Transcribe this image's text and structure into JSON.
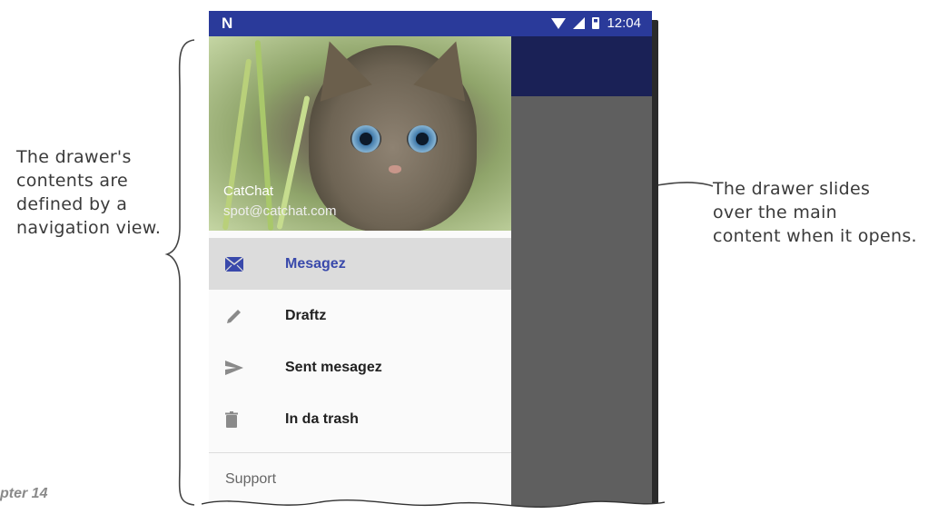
{
  "annotations": {
    "left": "The drawer's\ncontents are\ndefined by a\nnavigation view.",
    "right": "The drawer slides\nover the main\ncontent when it opens.",
    "chapter": "pter 14"
  },
  "status_bar": {
    "carrier": "N",
    "time": "12:04"
  },
  "drawer": {
    "header": {
      "name": "CatChat",
      "email": "spot@catchat.com"
    },
    "items": [
      {
        "label": "Mesagez",
        "icon": "email-icon",
        "selected": true
      },
      {
        "label": "Draftz",
        "icon": "pencil-icon",
        "selected": false
      },
      {
        "label": "Sent mesagez",
        "icon": "send-icon",
        "selected": false
      },
      {
        "label": "In da trash",
        "icon": "trash-icon",
        "selected": false
      }
    ],
    "section": "Support"
  },
  "colors": {
    "status_bar": "#2a3a9a",
    "app_bar": "#1a2156",
    "accent": "#3949ab",
    "main_content": "#5f5f5f"
  }
}
